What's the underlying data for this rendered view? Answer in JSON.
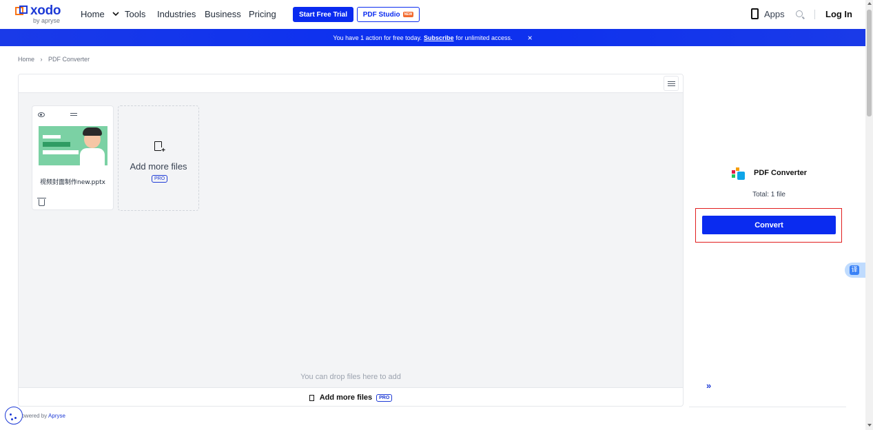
{
  "header": {
    "logo_text": "xodo",
    "logo_sub": "by apryse",
    "nav": {
      "home": "Home",
      "tools": "Tools",
      "industries": "Industries",
      "business": "Business",
      "pricing": "Pricing"
    },
    "trial_label": "Start Free Trial",
    "studio_label": "PDF Studio",
    "studio_badge": "NEW",
    "apps_label": "Apps",
    "login_label": "Log In"
  },
  "banner": {
    "prefix": "You have 1 action for free today.",
    "link": "Subscribe",
    "suffix": "for unlimited access.",
    "close": "×"
  },
  "breadcrumb": {
    "home": "Home",
    "separator": "›",
    "current": "PDF Converter"
  },
  "files": [
    {
      "name": "视频封面制作new.pptx"
    }
  ],
  "add_card": {
    "label": "Add more files",
    "badge": "PRO"
  },
  "drop_hint": "You can drop files here to add",
  "bottom_bar": {
    "label": "Add more files",
    "badge": "PRO"
  },
  "sidebar": {
    "title": "PDF Converter",
    "total": "Total: 1 file",
    "convert_label": "Convert",
    "collapse_label": "»"
  },
  "translate_label": "译",
  "footer": {
    "prefix": "Powered by",
    "link": "Apryse"
  },
  "colors": {
    "brand_blue": "#0a2bf0",
    "highlight_red": "#e11d1d"
  }
}
